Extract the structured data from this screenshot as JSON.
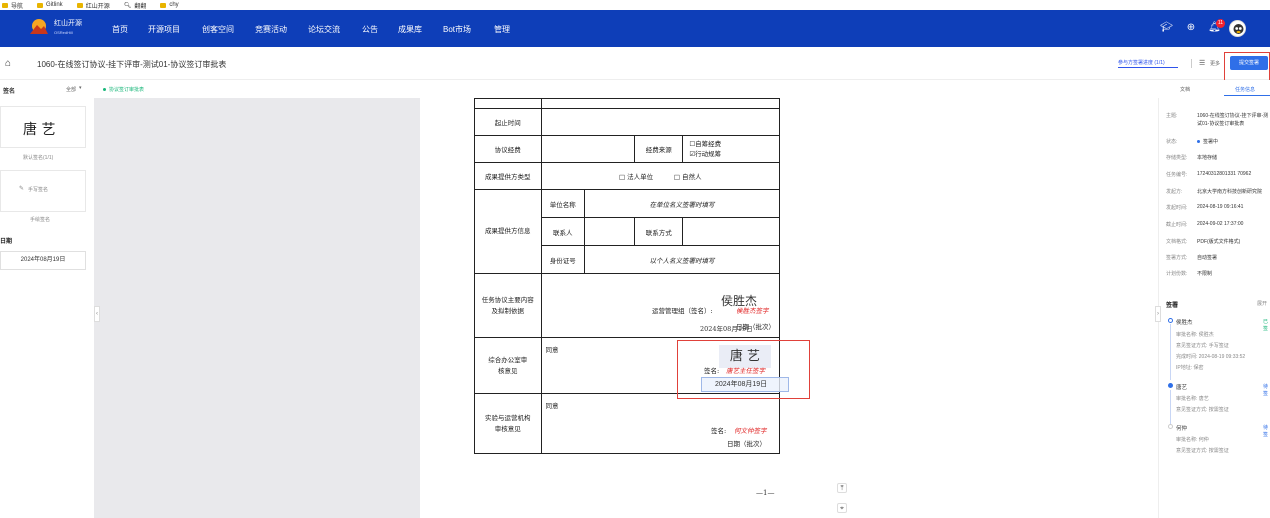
{
  "bookmarks": [
    {
      "label": "导航",
      "icon": "folder-icon"
    },
    {
      "label": "Gitlink",
      "icon": "folder-icon"
    },
    {
      "label": "红山开源",
      "icon": "folder-icon"
    },
    {
      "label": "翻翻",
      "icon": "search-icon"
    },
    {
      "label": "chy",
      "icon": "folder-icon"
    }
  ],
  "nav": {
    "logo_text": "红山开源",
    "logo_sub": "OSRedHill",
    "items": [
      "首页",
      "开源项目",
      "创客空间",
      "竞赛活动",
      "论坛交流",
      "公告",
      "成果库",
      "Bot市场",
      "管理"
    ],
    "badge_count": "11"
  },
  "header": {
    "doc_title": "1060-在线签订协议-挂下评审-测试01-协议签订审批表",
    "progress_text": "参与方签署进度 (1/1)",
    "more_label": "更多",
    "submit_label": "提交签署"
  },
  "subbar": {
    "left_label": "签名",
    "left_sort": "全部",
    "tab_label": "协议签订审批表",
    "right_tab1": "文档",
    "right_tab2": "任务信息"
  },
  "left": {
    "signature_name": "唐 艺",
    "default_label": "默认签名(1/1)",
    "handwrite_btn": "手写签名",
    "handwrite_caption": "手绘签名",
    "date_title": "日期",
    "date_value": "2024年08月19日"
  },
  "form": {
    "row_start": "起止时间",
    "row_fee": "协议经费",
    "fee_source": "经费来源",
    "fee_opt1": "☐自筹经费",
    "fee_opt2": "☑行动规筹",
    "row_provider_type": "成果提供方类型",
    "ptype1": "□ 法人单位",
    "ptype2": "□ 自然人",
    "row_provider_info": "成果提供方信息",
    "unit_name": "单位名称",
    "unit_hint": "在单位名义签署时填写",
    "contact": "联系人",
    "contact_way": "联系方式",
    "id_no": "身份证号",
    "id_hint": "以个人名义签署时填写",
    "row_task": "任务协议主要内容及拟制依据",
    "task_sign_label": "运营管理组（签名）:",
    "task_sign_red": "侯胜杰签字",
    "task_hand": "侯胜杰",
    "task_date": "2024年08月19日",
    "task_date_label": "日期（批次）",
    "row_office": "综合办公室审核意见",
    "agree": "同意",
    "office_sign_label": "签名:",
    "office_sign_red": "唐艺主任签字",
    "office_sig_name": "唐 艺",
    "office_date": "2024年08月19日",
    "row_tech": "实验与运营机构审核意见",
    "tech_sign_label": "签名:",
    "tech_sign_red": "何文仲签字",
    "tech_date_label": "日期（批次）"
  },
  "page_number": "—1—",
  "right": {
    "subject_label": "主题:",
    "subject_val": "1060-在线签订协议-挂下评审-测试01-协议签订审批表",
    "status_label": "状态:",
    "status_val": "签署中",
    "storage_label": "存储类型:",
    "storage_val": "本地存储",
    "task_no_label": "任务编号:",
    "task_no_val": "17240312801331 70962",
    "initiator_label": "发起方:",
    "initiator_val": "北京大学南方科技创新研究院",
    "start_label": "发起时间:",
    "start_val": "2024-08-19 09:16:41",
    "deadline_label": "截止时间:",
    "deadline_val": "2024-09-02 17:37:00",
    "format_label": "文档格式:",
    "format_val": "PDF(版式文件格式)",
    "sign_method_label": "签署方式:",
    "sign_method_val": "自动签署",
    "count_label": "计划份数:",
    "count_val": "不限制",
    "signers_title": "签署",
    "expand": "展开",
    "signers": [
      {
        "name": "侯胜杰",
        "status": "已签",
        "sub1": "审批名称: 侯胜杰",
        "sub2": "意见签证方式: 手写签证",
        "sub3": "完成时间: 2024-08-19 09:33:52",
        "sub4": "IP地址: 保密"
      },
      {
        "name": "唐艺",
        "status": "待签",
        "sub1": "审批名称: 唐艺",
        "sub2": "意见签证方式: 按需签证"
      },
      {
        "name": "何仲",
        "status": "待签",
        "sub1": "审批名称: 何仲",
        "sub2": "意见签证方式: 按需签证"
      }
    ]
  },
  "colors": {
    "nav": "#0e3eb8",
    "accent": "#2f6fe8",
    "red": "#e0413a"
  }
}
